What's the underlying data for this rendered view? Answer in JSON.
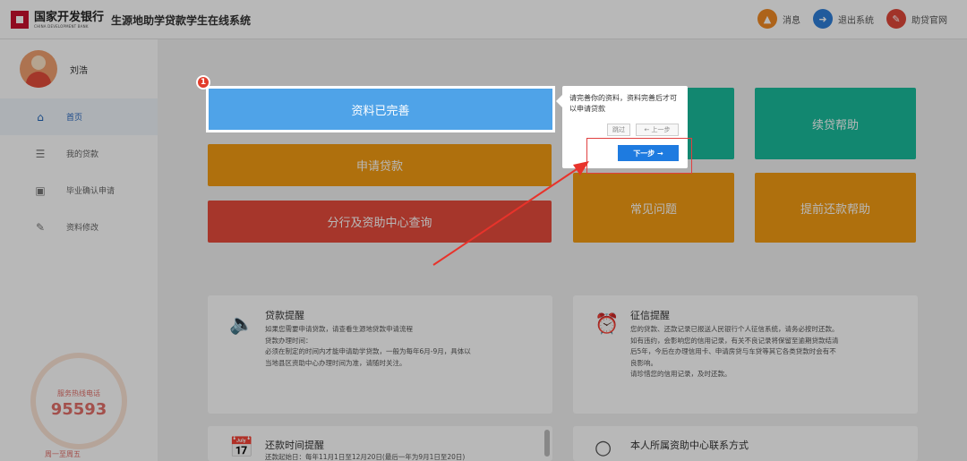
{
  "header": {
    "logo_cn": "国家开发银行",
    "logo_en": "CHINA DEVELOPMENT BANK",
    "system_name": "生源地助学贷款学生在线系统",
    "actions": [
      {
        "label": "消息",
        "icon": "bell-icon",
        "color": "#f08a24"
      },
      {
        "label": "退出系统",
        "icon": "logout-icon",
        "color": "#2f7fd8"
      },
      {
        "label": "助贷官网",
        "icon": "external-link-icon",
        "color": "#e0473a"
      }
    ]
  },
  "sidebar": {
    "username": "刘浩",
    "items": [
      {
        "label": "首页",
        "icon": "home-icon",
        "active": true
      },
      {
        "label": "我的贷款",
        "icon": "document-list-icon",
        "active": false
      },
      {
        "label": "毕业确认申请",
        "icon": "monitor-icon",
        "active": false
      },
      {
        "label": "资料修改",
        "icon": "edit-icon",
        "active": false
      }
    ],
    "hotline_label": "服务热线电话",
    "hotline_number": "95593",
    "hotline_hours": "周一至周五"
  },
  "main": {
    "buttons": {
      "profile_complete": "资料已完善",
      "apply_loan": "申请贷款",
      "branch_query": "分行及资助中心查询",
      "renew_help": "续贷帮助",
      "faq": "常见问题",
      "prepay_help": "提前还款帮助"
    },
    "colors": {
      "blue": "#4fa3e8",
      "orange": "#f39c12",
      "red": "#e74c3c",
      "teal": "#1abc9c"
    },
    "cards": {
      "loan_reminder": {
        "title": "贷款提醒",
        "lines": [
          "如果您需要申请贷款，请查看生源地贷款申请流程",
          "贷款办理时间：",
          "必须在制定的时间内才能申请助学贷款，一般为每年6月-9月，具体以",
          "当地县区资助中心办理时间为准，请随时关注。"
        ]
      },
      "credit_reminder": {
        "title": "征信提醒",
        "lines": [
          "您的贷款、还款记录已报送人民银行个人征信系统，请务必按时还款。",
          "如有违约，会影响您的信用记录，有关不良记录将保留至逾期贷款结清",
          "后5年，今后在办理信用卡、申请房贷与车贷等其它各类贷款时会有不",
          "良影响。",
          "请珍惜您的信用记录，及时还款。"
        ]
      },
      "repayment_time": {
        "title": "还款时间提醒",
        "first_line": "还款起始日：每年11月1日至12月20日(最后一年为9月1日至20日)"
      },
      "contact": {
        "title": "本人所属资助中心联系方式"
      }
    }
  },
  "guide": {
    "step": "1",
    "text": "请完善你的资料，资料完善后才可以申请贷款",
    "skip_label": "跳过",
    "prev_label": "← 上一步",
    "next_label": "下一步 →"
  }
}
